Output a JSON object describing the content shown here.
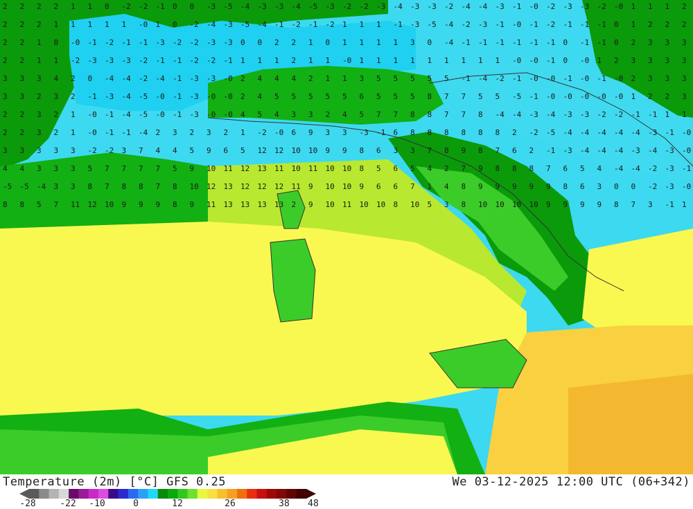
{
  "map": {
    "layer": "Temperature (2m) [°C]",
    "colors": {
      "sea_cold": "#0fd0f0",
      "sea_cyan": "#3dd9f0",
      "green_dark": "#0a9a0a",
      "green": "#12b012",
      "green_light": "#3ccc2a",
      "yellow_green": "#b8e830",
      "yellow": "#f8f850",
      "orange_light": "#f8d040",
      "orange": "#f4b830"
    },
    "sample_values": [
      {
        "r": 0,
        "vals": [
          "2",
          "2",
          "2",
          "2",
          "1",
          "1",
          "0",
          "-2",
          "-2",
          "-1",
          "0",
          "0",
          "-3",
          "-5",
          "-4",
          "-3",
          "-3",
          "-4",
          "-5",
          "-3",
          "-2",
          "-2",
          "-3",
          "-4",
          "-3",
          "-3",
          "-2",
          "-4",
          "-4",
          "-3",
          "-1",
          "-0",
          "-2",
          "-3",
          "-3",
          "-2",
          "-0",
          "1",
          "1",
          "1",
          "2"
        ]
      },
      {
        "r": 1,
        "vals": [
          "2",
          "2",
          "2",
          "1",
          "1",
          "1",
          "1",
          "1",
          "-0",
          "1",
          "0",
          "-2",
          "-4",
          "-3",
          "-5",
          "-4",
          "-1",
          "-2",
          "-1",
          "-2",
          "1",
          "1",
          "1",
          "-1",
          "-3",
          "-5",
          "-4",
          "-2",
          "-3",
          "-1",
          "-0",
          "-1",
          "-2",
          "-1",
          "-1",
          "-1",
          "0",
          "1",
          "2",
          "2",
          "2"
        ]
      },
      {
        "r": 2,
        "vals": [
          "2",
          "2",
          "1",
          "0",
          "-0",
          "-1",
          "-2",
          "-1",
          "-1",
          "-3",
          "-2",
          "-2",
          "-3",
          "-3",
          "0",
          "0",
          "2",
          "2",
          "1",
          "0",
          "1",
          "1",
          "1",
          "1",
          "3",
          "0",
          "-4",
          "-1",
          "-1",
          "-1",
          "-1",
          "-1",
          "-1",
          "0",
          "-1",
          "-1",
          "0",
          "2",
          "3",
          "3",
          "3"
        ]
      },
      {
        "r": 3,
        "vals": [
          "2",
          "2",
          "1",
          "1",
          "-2",
          "-3",
          "-3",
          "-3",
          "-2",
          "-1",
          "-1",
          "-2",
          "-2",
          "-1",
          "1",
          "1",
          "1",
          "2",
          "1",
          "1",
          "-0",
          "1",
          "1",
          "1",
          "1",
          "1",
          "1",
          "1",
          "1",
          "1",
          "-0",
          "-0",
          "-1",
          "0",
          "-0",
          "1",
          "2",
          "3",
          "3",
          "3",
          "3"
        ]
      },
      {
        "r": 4,
        "vals": [
          "3",
          "3",
          "3",
          "4",
          "2",
          "0",
          "-4",
          "-4",
          "-2",
          "-4",
          "-1",
          "-3",
          "-3",
          "-0",
          "2",
          "4",
          "4",
          "4",
          "2",
          "1",
          "1",
          "3",
          "5",
          "5",
          "5",
          "5",
          "5",
          "-1",
          "-4",
          "-2",
          "-1",
          "-0",
          "-0",
          "-1",
          "-0",
          "-1",
          "-0",
          "2",
          "3",
          "3",
          "3"
        ]
      },
      {
        "r": 5,
        "vals": [
          "3",
          "3",
          "2",
          "3",
          "2",
          "-1",
          "-3",
          "-4",
          "-5",
          "-0",
          "-1",
          "-3",
          "-0",
          "-0",
          "2",
          "4",
          "5",
          "5",
          "5",
          "5",
          "5",
          "6",
          "5",
          "5",
          "5",
          "8",
          "7",
          "7",
          "5",
          "5",
          "-5",
          "-1",
          "-0",
          "-0",
          "-0",
          "-0",
          "-0",
          "1",
          "2",
          "2",
          "3"
        ]
      },
      {
        "r": 6,
        "vals": [
          "2",
          "2",
          "3",
          "2",
          "1",
          "-0",
          "-1",
          "-4",
          "-5",
          "-0",
          "-1",
          "-3",
          "-0",
          "-0",
          "4",
          "5",
          "4",
          "3",
          "3",
          "2",
          "4",
          "5",
          "7",
          "7",
          "8",
          "8",
          "7",
          "7",
          "8",
          "-4",
          "-4",
          "-3",
          "-4",
          "-3",
          "-3",
          "-2",
          "-2",
          "-1",
          "-1",
          "1",
          "1"
        ]
      },
      {
        "r": 7,
        "vals": [
          "2",
          "2",
          "3",
          "2",
          "1",
          "-0",
          "-1",
          "-1",
          "-4",
          "2",
          "3",
          "2",
          "3",
          "2",
          "1",
          "-2",
          "-0",
          "6",
          "9",
          "3",
          "3",
          "-3",
          "-1",
          "6",
          "8",
          "8",
          "8",
          "8",
          "8",
          "8",
          "2",
          "-2",
          "-5",
          "-4",
          "-4",
          "-4",
          "-4",
          "-4",
          "-3",
          "-1",
          "-0"
        ]
      },
      {
        "r": 8,
        "vals": [
          "3",
          "3",
          "3",
          "3",
          "3",
          "-2",
          "-2",
          "3",
          "7",
          "4",
          "4",
          "5",
          "9",
          "6",
          "5",
          "12",
          "12",
          "10",
          "10",
          "9",
          "9",
          "8",
          "6",
          "3",
          "3",
          "7",
          "8",
          "9",
          "8",
          "7",
          "6",
          "2",
          "-1",
          "-3",
          "-4",
          "-4",
          "-4",
          "-3",
          "-4",
          "-3",
          "-0"
        ]
      },
      {
        "r": 9,
        "vals": [
          "4",
          "4",
          "3",
          "3",
          "3",
          "5",
          "7",
          "7",
          "7",
          "7",
          "5",
          "9",
          "10",
          "11",
          "12",
          "13",
          "11",
          "10",
          "11",
          "10",
          "10",
          "8",
          "5",
          "6",
          "5",
          "4",
          "2",
          "7",
          "9",
          "8",
          "8",
          "8",
          "7",
          "6",
          "5",
          "4",
          "-4",
          "-4",
          "-2",
          "-3",
          "-1"
        ]
      },
      {
        "r": 10,
        "vals": [
          "-5",
          "-5",
          "-4",
          "3",
          "3",
          "8",
          "7",
          "8",
          "8",
          "7",
          "8",
          "10",
          "12",
          "13",
          "12",
          "12",
          "12",
          "11",
          "9",
          "10",
          "10",
          "9",
          "6",
          "6",
          "7",
          "1",
          "4",
          "8",
          "9",
          "9",
          "9",
          "9",
          "9",
          "8",
          "6",
          "3",
          "0",
          "0",
          "-2",
          "-3",
          "-0"
        ]
      },
      {
        "r": 11,
        "vals": [
          "8",
          "8",
          "5",
          "7",
          "11",
          "12",
          "10",
          "9",
          "9",
          "9",
          "8",
          "9",
          "11",
          "13",
          "13",
          "13",
          "13",
          "2",
          "9",
          "10",
          "11",
          "10",
          "10",
          "8",
          "10",
          "5",
          "3",
          "8",
          "10",
          "10",
          "10",
          "10",
          "9",
          "9",
          "9",
          "9",
          "8",
          "7",
          "3",
          "-1",
          "1"
        ]
      }
    ]
  },
  "footer": {
    "title_left": "Temperature (2m) [°C] GFS 0.25",
    "title_right": "We 03-12-2025 12:00 UTC (06+342)"
  },
  "colorbar": {
    "ticks": [
      "-28",
      "-22",
      "-10",
      "0",
      "12",
      "26",
      "38",
      "48"
    ],
    "stops": [
      "#5a5a5a",
      "#8a8a8a",
      "#b4b4b4",
      "#d8d8d8",
      "#6a0a6a",
      "#9a1a9a",
      "#c82ac8",
      "#e04ae0",
      "#3a0a8a",
      "#2a2ad0",
      "#2a6af0",
      "#2aa0f8",
      "#20d8f8",
      "#0a8a0a",
      "#0aaa0a",
      "#30c820",
      "#70e030",
      "#e8f840",
      "#f8e040",
      "#f8c030",
      "#f4a020",
      "#f07010",
      "#e83010",
      "#c81010",
      "#a00808",
      "#800808",
      "#600404",
      "#400202"
    ]
  }
}
